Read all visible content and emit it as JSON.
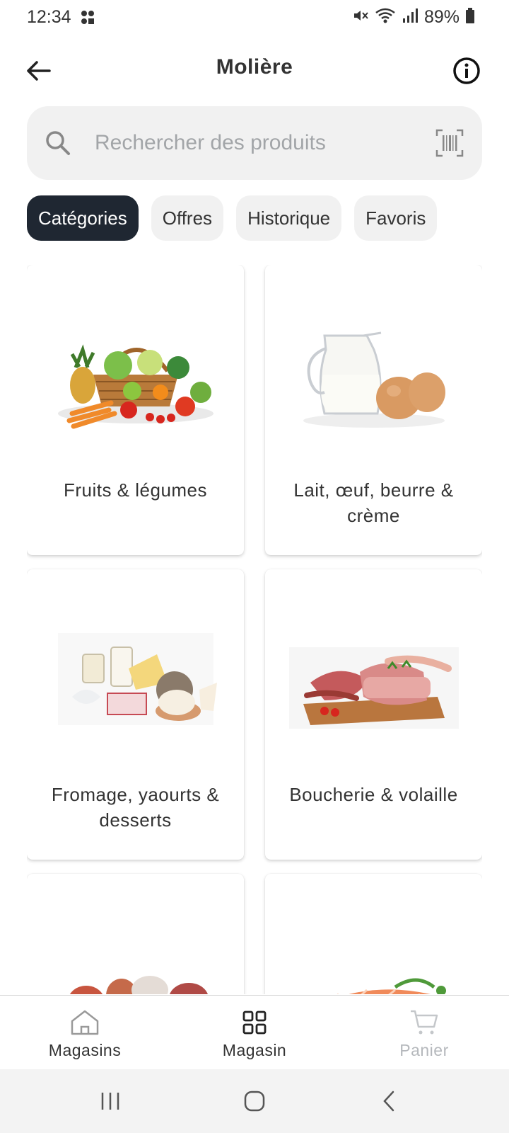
{
  "status_bar": {
    "time": "12:34",
    "battery": "89%"
  },
  "header": {
    "title": "Molière"
  },
  "search": {
    "placeholder": "Rechercher des produits"
  },
  "tabs": [
    {
      "label": "Catégories",
      "active": true
    },
    {
      "label": "Offres",
      "active": false
    },
    {
      "label": "Historique",
      "active": false
    },
    {
      "label": "Favoris",
      "active": false
    }
  ],
  "categories": [
    {
      "label": "Fruits & légumes",
      "icon": "fruits-vegetables-image"
    },
    {
      "label": "Lait, œuf, beurre & crème",
      "icon": "milk-eggs-image"
    },
    {
      "label": "Fromage, yaourts & desserts",
      "icon": "cheese-yogurt-image"
    },
    {
      "label": "Boucherie & volaille",
      "icon": "meat-poultry-image"
    },
    {
      "label": "",
      "icon": "charcuterie-image"
    },
    {
      "label": "",
      "icon": "fish-image"
    }
  ],
  "bottom_nav": [
    {
      "label": "Magasins",
      "icon": "home-icon",
      "enabled": true
    },
    {
      "label": "Magasin",
      "icon": "grid-icon",
      "enabled": true
    },
    {
      "label": "Panier",
      "icon": "cart-icon",
      "enabled": false
    }
  ],
  "colors": {
    "accent": "#1f2732",
    "chip_bg": "#f1f1f1",
    "disabled": "#b5b8bc"
  }
}
